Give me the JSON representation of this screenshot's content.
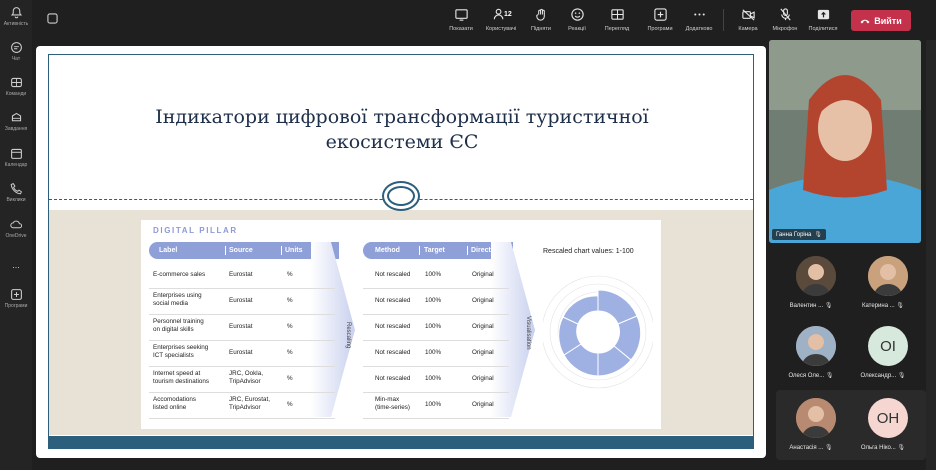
{
  "rail": {
    "items": [
      {
        "label": "Активність"
      },
      {
        "label": "Чат"
      },
      {
        "label": "Команди"
      },
      {
        "label": "Завдання"
      },
      {
        "label": "Календар"
      },
      {
        "label": "Виклики"
      },
      {
        "label": "OneDrive"
      },
      {
        "label": "..."
      },
      {
        "label": "Програми"
      }
    ]
  },
  "toolbar": {
    "participant_count": "12",
    "buttons": [
      {
        "label": "Показати",
        "icon": "screen-icon"
      },
      {
        "label": "Користувачі",
        "icon": "people-icon"
      },
      {
        "label": "Підняти",
        "icon": "hand-icon"
      },
      {
        "label": "Реакції",
        "icon": "smile-icon"
      },
      {
        "label": "Перегляд",
        "icon": "view-icon"
      },
      {
        "label": "Програми",
        "icon": "plus-icon"
      },
      {
        "label": "Додатково",
        "icon": "more-icon"
      },
      {
        "label": "Камера",
        "icon": "camera-icon"
      },
      {
        "label": "Мікрофон",
        "icon": "mic-off-icon"
      },
      {
        "label": "Поділитися",
        "icon": "share-icon"
      }
    ],
    "leave_label": "Вийти",
    "leave_color": "#c4314b"
  },
  "slide": {
    "title_line1": "Індикатори цифрової трансформації туристичної",
    "title_line2": "екосистеми ЄС",
    "pillar": "DIGITAL PILLAR",
    "headers_left": [
      "Label",
      "Source",
      "Units"
    ],
    "headers_right": [
      "Method",
      "Target",
      "Direction"
    ],
    "arrow1_label": "Rescaling",
    "arrow2_label": "Visualisation",
    "chart_caption": "Rescaled chart values: 1-100",
    "rows": [
      {
        "label1": "E-commerce sales",
        "label2": "",
        "source1": "Eurostat",
        "source2": "",
        "units": "%",
        "method1": "Not rescaled",
        "method2": "",
        "target": "100%",
        "direction": "Original"
      },
      {
        "label1": "Enterprises using",
        "label2": "social media",
        "source1": "Eurostat",
        "source2": "",
        "units": "%",
        "method1": "Not rescaled",
        "method2": "",
        "target": "100%",
        "direction": "Original"
      },
      {
        "label1": "Personnel training",
        "label2": "on digital skills",
        "source1": "Eurostat",
        "source2": "",
        "units": "%",
        "method1": "Not rescaled",
        "method2": "",
        "target": "100%",
        "direction": "Original"
      },
      {
        "label1": "Enterprises seeking",
        "label2": "ICT specialists",
        "source1": "Eurostat",
        "source2": "",
        "units": "%",
        "method1": "Not rescaled",
        "method2": "",
        "target": "100%",
        "direction": "Original"
      },
      {
        "label1": "Internet speed at",
        "label2": "tourism destinations",
        "source1": "JRC, Ookla,",
        "source2": "TripAdvisor",
        "units": "%",
        "method1": "Not rescaled",
        "method2": "",
        "target": "100%",
        "direction": "Original"
      },
      {
        "label1": "Accomodations",
        "label2": "listed online",
        "source1": "JRC, Eurostat,",
        "source2": "TripAdvisor",
        "units": "%",
        "method1": "Min-max",
        "method2": "(time-series)",
        "target": "100%",
        "direction": "Original"
      }
    ]
  },
  "participants": {
    "featured": {
      "name": "Ганна Горіна"
    },
    "tiles": [
      {
        "name": "Валентин ...",
        "initials": "",
        "avatar_color": "#5a4a3c"
      },
      {
        "name": "Катерина ...",
        "initials": "",
        "avatar_color": "#c9a27d"
      },
      {
        "name": "Олеся Оле...",
        "initials": "",
        "avatar_color": "#9fb1c4"
      },
      {
        "name": "Олександр...",
        "initials": "OI",
        "avatar_color": "#d7e8dc"
      },
      {
        "name": "Анастасія ...",
        "initials": "",
        "avatar_color": "#b98a72"
      },
      {
        "name": "Ольга Ніко...",
        "initials": "OH",
        "avatar_color": "#f6d6d0"
      }
    ]
  }
}
